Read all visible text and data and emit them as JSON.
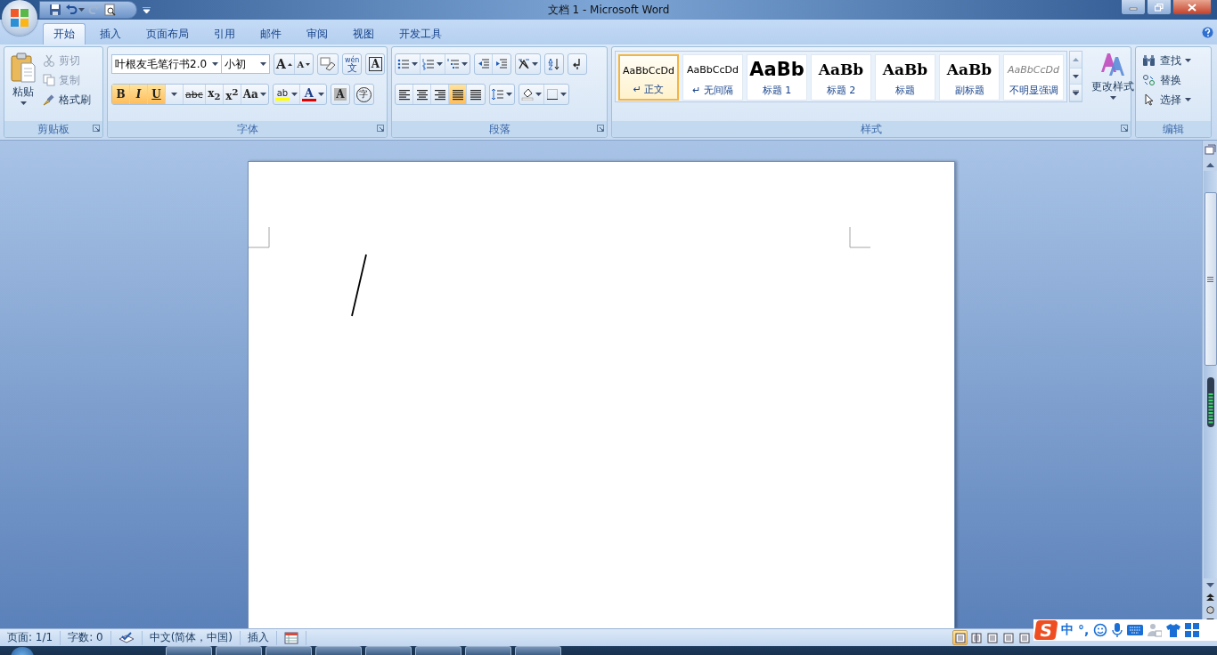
{
  "window": {
    "title": "文档 1 - Microsoft Word"
  },
  "tabs": [
    {
      "label": "开始",
      "selected": true
    },
    {
      "label": "插入",
      "selected": false
    },
    {
      "label": "页面布局",
      "selected": false
    },
    {
      "label": "引用",
      "selected": false
    },
    {
      "label": "邮件",
      "selected": false
    },
    {
      "label": "审阅",
      "selected": false
    },
    {
      "label": "视图",
      "selected": false
    },
    {
      "label": "开发工具",
      "selected": false
    }
  ],
  "clipboard": {
    "label": "剪贴板",
    "paste": "粘贴",
    "items": [
      {
        "kind": "cut",
        "label": "剪切",
        "disabled": true
      },
      {
        "kind": "copy",
        "label": "复制",
        "disabled": true
      },
      {
        "kind": "painter",
        "label": "格式刷",
        "disabled": false
      }
    ]
  },
  "font": {
    "label": "字体",
    "font_name": "叶根友毛笔行书2.0",
    "font_size": "小初",
    "grow": "A",
    "shrink": "A",
    "phonetic": {
      "top": "wén",
      "bottom": "文"
    },
    "border": "A",
    "toggles": [
      {
        "kind": "bold",
        "text": "B",
        "on": true
      },
      {
        "kind": "italic",
        "text": "I",
        "on": true
      },
      {
        "kind": "underline",
        "text": "U",
        "on": true
      },
      {
        "kind": "strike",
        "text": "abc",
        "on": false
      },
      {
        "kind": "sub",
        "text": "x$_{2}$",
        "on": false
      },
      {
        "kind": "sup",
        "text": "x$^{2}$",
        "on": false
      }
    ],
    "change_case": "Aa",
    "highlight": "ab",
    "font_color_letter": "A",
    "shading": "A",
    "enclose": "字"
  },
  "paragraph": {
    "label": "段落",
    "alignment": [
      {
        "kind": "left",
        "selected": false
      },
      {
        "kind": "center",
        "selected": false
      },
      {
        "kind": "right",
        "selected": false
      },
      {
        "kind": "justify",
        "selected": true
      },
      {
        "kind": "distributed",
        "selected": false
      }
    ]
  },
  "styles": {
    "label": "样式",
    "change_styles": "更改样式",
    "items": [
      {
        "kind": "normal",
        "preview": "AaBbCcDd",
        "name": "↵ 正文",
        "selected": true
      },
      {
        "kind": "normal",
        "preview": "AaBbCcDd",
        "name": "↵ 无间隔",
        "selected": false
      },
      {
        "kind": "heading1",
        "preview": "AaBb",
        "name": "标题 1",
        "selected": false
      },
      {
        "kind": "heading2",
        "preview": "AaBb",
        "name": "标题 2",
        "selected": false
      },
      {
        "kind": "title",
        "preview": "AaBb",
        "name": "标题",
        "selected": false
      },
      {
        "kind": "title",
        "preview": "AaBb",
        "name": "副标题",
        "selected": false
      },
      {
        "kind": "emphasis",
        "preview": "AaBbCcDd",
        "name": "不明显强调",
        "selected": false
      }
    ]
  },
  "editing": {
    "label": "编辑",
    "items": [
      {
        "kind": "find",
        "label": "查找"
      },
      {
        "kind": "replace",
        "label": "替换"
      },
      {
        "kind": "select",
        "label": "选择"
      }
    ]
  },
  "status_bar": {
    "items": [
      {
        "kind": "text",
        "text": "页面: 1/1"
      },
      {
        "kind": "text",
        "text": "字数: 0"
      },
      {
        "kind": "spell"
      },
      {
        "kind": "text",
        "text": "中文(简体，中国)"
      },
      {
        "kind": "text",
        "text": "插入"
      },
      {
        "kind": "macro"
      }
    ],
    "views": [
      {
        "selected": true
      },
      {
        "selected": false
      },
      {
        "selected": false
      },
      {
        "selected": false
      },
      {
        "selected": false
      }
    ]
  },
  "ime": {
    "logo": "S",
    "mode": "中",
    "punct": "°,"
  }
}
